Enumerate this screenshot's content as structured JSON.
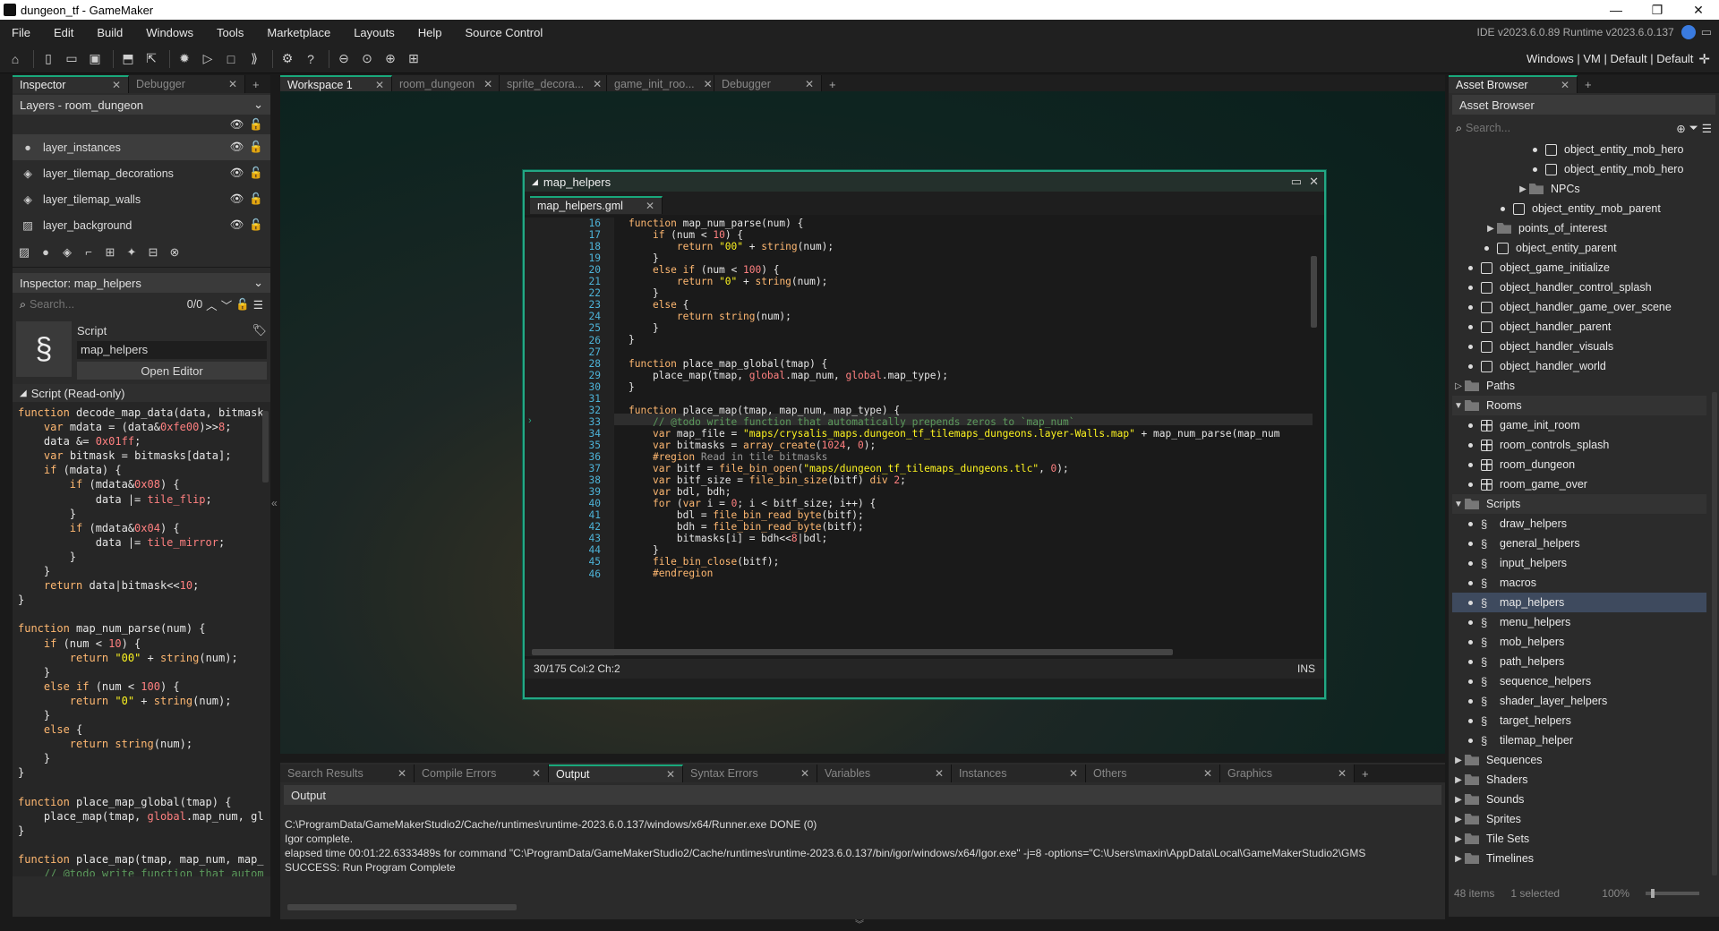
{
  "window": {
    "title": "dungeon_tf - GameMaker",
    "controls": [
      "—",
      "❐",
      "✕"
    ]
  },
  "menu": {
    "items": [
      "File",
      "Edit",
      "Build",
      "Windows",
      "Tools",
      "Marketplace",
      "Layouts",
      "Help",
      "Source Control"
    ],
    "version": "IDE v2023.6.0.89  Runtime v2023.6.0.137"
  },
  "toolbar": {
    "right": "Windows | VM | Default | Default"
  },
  "inspector": {
    "tabs": [
      {
        "label": "Inspector",
        "active": true
      },
      {
        "label": "Debugger",
        "active": false
      }
    ],
    "layers_dropdown": "Layers - room_dungeon",
    "layers": [
      {
        "name": "layer_instances",
        "icon": "●"
      },
      {
        "name": "layer_tilemap_decorations",
        "icon": "◈"
      },
      {
        "name": "layer_tilemap_walls",
        "icon": "◈"
      },
      {
        "name": "layer_background",
        "icon": "▨"
      }
    ],
    "inspector_dropdown": "Inspector: map_helpers",
    "search_placeholder": "Search...",
    "search_count": "0/0",
    "script_header": "Script",
    "script_name": "map_helpers",
    "open_editor": "Open Editor",
    "readonly_header": "Script (Read-only)"
  },
  "workspace": {
    "tabs": [
      {
        "label": "Workspace 1",
        "active": true
      },
      {
        "label": "room_dungeon"
      },
      {
        "label": "sprite_decora..."
      },
      {
        "label": "game_init_roo..."
      },
      {
        "label": "Debugger"
      }
    ]
  },
  "code_window": {
    "title": "map_helpers",
    "file_tab": "map_helpers.gml",
    "status": "30/175 Col:2 Ch:2",
    "mode": "INS",
    "line_numbers": [
      "16",
      "17",
      "18",
      "19",
      "20",
      "21",
      "22",
      "23",
      "24",
      "25",
      "26",
      "27",
      "28",
      "29",
      "30",
      "31",
      "32",
      "33",
      "34",
      "35",
      "36",
      "37",
      "38",
      "39",
      "40",
      "41",
      "42",
      "43",
      "44",
      "45",
      "46"
    ]
  },
  "asset_browser": {
    "tab": "Asset Browser",
    "header": "Asset Browser",
    "search_placeholder": "Search...",
    "items": [
      {
        "label": "object_entity_mob_hero",
        "indent": 5,
        "type": "obj"
      },
      {
        "label": "object_entity_mob_hero",
        "indent": 5,
        "type": "obj"
      },
      {
        "label": "NPCs",
        "indent": 4,
        "type": "folder",
        "arrow": "▶"
      },
      {
        "label": "object_entity_mob_parent",
        "indent": 3,
        "type": "obj"
      },
      {
        "label": "points_of_interest",
        "indent": 2,
        "type": "folder",
        "arrow": "▶"
      },
      {
        "label": "object_entity_parent",
        "indent": 2,
        "type": "obj"
      },
      {
        "label": "object_game_initialize",
        "indent": 1,
        "type": "obj"
      },
      {
        "label": "object_handler_control_splash",
        "indent": 1,
        "type": "obj"
      },
      {
        "label": "object_handler_game_over_scene",
        "indent": 1,
        "type": "obj"
      },
      {
        "label": "object_handler_parent",
        "indent": 1,
        "type": "obj"
      },
      {
        "label": "object_handler_visuals",
        "indent": 1,
        "type": "obj"
      },
      {
        "label": "object_handler_world",
        "indent": 1,
        "type": "obj"
      },
      {
        "label": "Paths",
        "indent": 0,
        "type": "folder",
        "arrow": "▷"
      },
      {
        "label": "Rooms",
        "indent": 0,
        "type": "folder",
        "arrow": "▼",
        "hl": true
      },
      {
        "label": "game_init_room",
        "indent": 1,
        "type": "room",
        "home": true
      },
      {
        "label": "room_controls_splash",
        "indent": 1,
        "type": "room"
      },
      {
        "label": "room_dungeon",
        "indent": 1,
        "type": "room"
      },
      {
        "label": "room_game_over",
        "indent": 1,
        "type": "room"
      },
      {
        "label": "Scripts",
        "indent": 0,
        "type": "folder",
        "arrow": "▼",
        "hl": true
      },
      {
        "label": "draw_helpers",
        "indent": 1,
        "type": "script"
      },
      {
        "label": "general_helpers",
        "indent": 1,
        "type": "script"
      },
      {
        "label": "input_helpers",
        "indent": 1,
        "type": "script"
      },
      {
        "label": "macros",
        "indent": 1,
        "type": "script"
      },
      {
        "label": "map_helpers",
        "indent": 1,
        "type": "script",
        "selected": true
      },
      {
        "label": "menu_helpers",
        "indent": 1,
        "type": "script"
      },
      {
        "label": "mob_helpers",
        "indent": 1,
        "type": "script"
      },
      {
        "label": "path_helpers",
        "indent": 1,
        "type": "script"
      },
      {
        "label": "sequence_helpers",
        "indent": 1,
        "type": "script"
      },
      {
        "label": "shader_layer_helpers",
        "indent": 1,
        "type": "script"
      },
      {
        "label": "target_helpers",
        "indent": 1,
        "type": "script"
      },
      {
        "label": "tilemap_helper",
        "indent": 1,
        "type": "script"
      },
      {
        "label": "Sequences",
        "indent": 0,
        "type": "folder",
        "arrow": "▶"
      },
      {
        "label": "Shaders",
        "indent": 0,
        "type": "folder",
        "arrow": "▶"
      },
      {
        "label": "Sounds",
        "indent": 0,
        "type": "folder",
        "arrow": "▶"
      },
      {
        "label": "Sprites",
        "indent": 0,
        "type": "folder",
        "arrow": "▶"
      },
      {
        "label": "Tile Sets",
        "indent": 0,
        "type": "folder",
        "arrow": "▶"
      },
      {
        "label": "Timelines",
        "indent": 0,
        "type": "folder",
        "arrow": "▶"
      }
    ],
    "footer": {
      "count": "48 items",
      "selected": "1 selected",
      "zoom": "100%"
    }
  },
  "output": {
    "tabs": [
      "Search Results",
      "Compile Errors",
      "Output",
      "Syntax Errors",
      "Variables",
      "Instances",
      "Others",
      "Graphics"
    ],
    "active": "Output",
    "header": "Output",
    "lines": [
      "C:\\ProgramData/GameMakerStudio2/Cache/runtimes\\runtime-2023.6.0.137/windows/x64/Runner.exe DONE (0)",
      "Igor complete.",
      "elapsed time 00:01:22.6333489s for command \"C:\\ProgramData/GameMakerStudio2/Cache/runtimes\\runtime-2023.6.0.137/bin/igor/windows/x64/Igor.exe\" -j=8  -options=\"C:\\Users\\maxin\\AppData\\Local\\GameMakerStudio2\\GMS",
      "SUCCESS: Run Program Complete"
    ]
  }
}
